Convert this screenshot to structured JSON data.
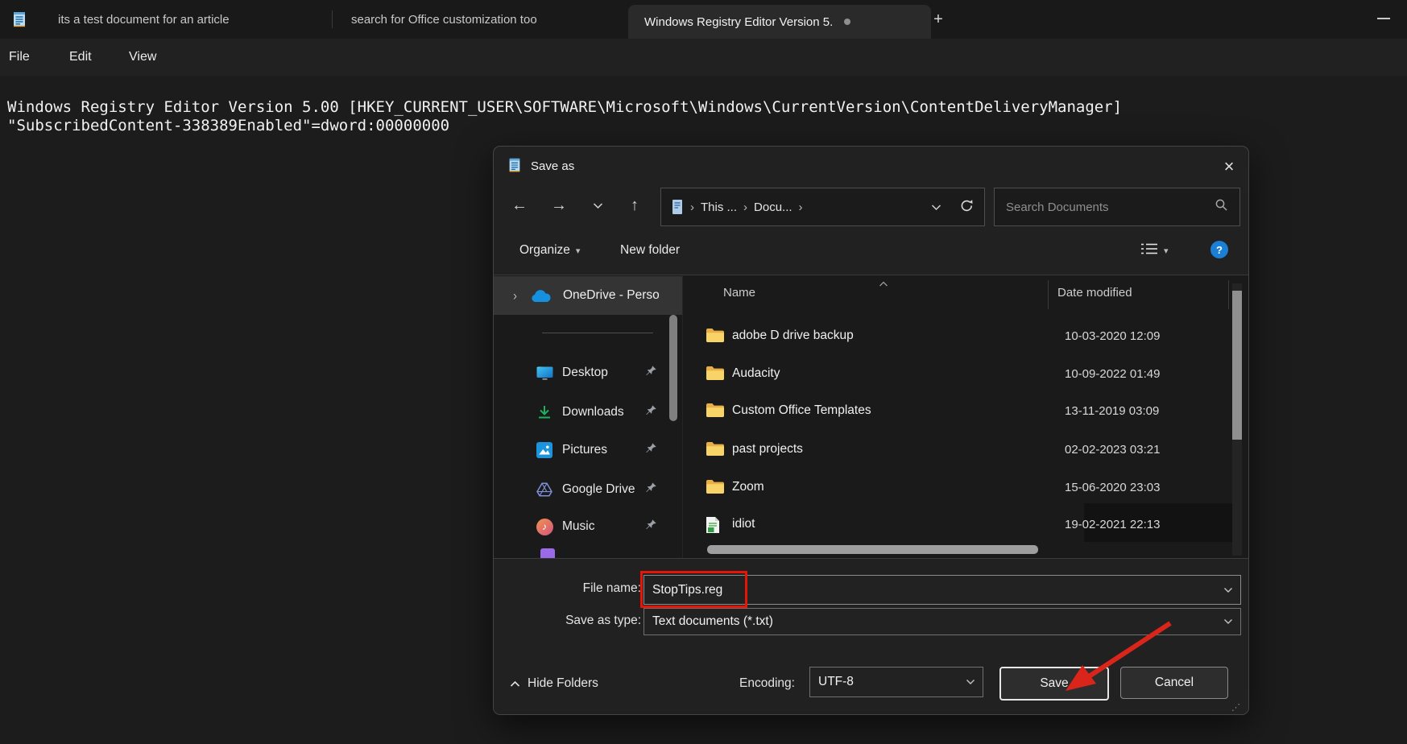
{
  "titlebar": {
    "tabs": [
      {
        "label": "its a test document for an article"
      },
      {
        "label": "search for Office customization too"
      },
      {
        "label": "Windows Registry Editor Version 5."
      }
    ],
    "new_tab_label": "+"
  },
  "menubar": {
    "items": [
      "File",
      "Edit",
      "View"
    ]
  },
  "editor": {
    "lines": [
      "Windows Registry Editor Version 5.00 [HKEY_CURRENT_USER\\SOFTWARE\\Microsoft\\Windows\\CurrentVersion\\ContentDeliveryManager]",
      "\"SubscribedContent-338389Enabled\"=dword:00000000"
    ]
  },
  "dialog": {
    "title": "Save as",
    "close_glyph": "×",
    "address": {
      "crumbs": [
        "This ...",
        "Docu..."
      ],
      "separator": "›"
    },
    "search": {
      "placeholder": "Search Documents"
    },
    "toolbar": {
      "organize": "Organize",
      "new_folder": "New folder",
      "help": "?"
    },
    "sidebar": {
      "items": [
        {
          "label": "OneDrive - Perso"
        },
        {
          "label": "Desktop"
        },
        {
          "label": "Downloads"
        },
        {
          "label": "Pictures"
        },
        {
          "label": "Google Drive"
        },
        {
          "label": "Music"
        }
      ]
    },
    "list": {
      "columns": [
        "Name",
        "Date modified"
      ],
      "rows": [
        {
          "name": "adobe D drive backup",
          "date": "10-03-2020 12:09",
          "type": "folder"
        },
        {
          "name": "Audacity",
          "date": "10-09-2022 01:49",
          "type": "folder"
        },
        {
          "name": "Custom Office Templates",
          "date": "13-11-2019 03:09",
          "type": "folder"
        },
        {
          "name": "past projects",
          "date": "02-02-2023 03:21",
          "type": "folder"
        },
        {
          "name": "Zoom",
          "date": "15-06-2020 23:03",
          "type": "folder"
        },
        {
          "name": "idiot",
          "date": "19-02-2021 22:13",
          "type": "file"
        }
      ]
    },
    "fields": {
      "file_name_label": "File name:",
      "file_name_value": "StopTips.reg",
      "save_type_label": "Save as type:",
      "save_type_value": "Text documents (*.txt)",
      "encoding_label": "Encoding:",
      "encoding_value": "UTF-8"
    },
    "buttons": {
      "save": "Save",
      "cancel": "Cancel",
      "hide_folders": "Hide Folders"
    }
  },
  "colors": {
    "annotation_red": "#e51607",
    "help_blue": "#1c7fd6",
    "folder_yellow": "#f7d368"
  }
}
